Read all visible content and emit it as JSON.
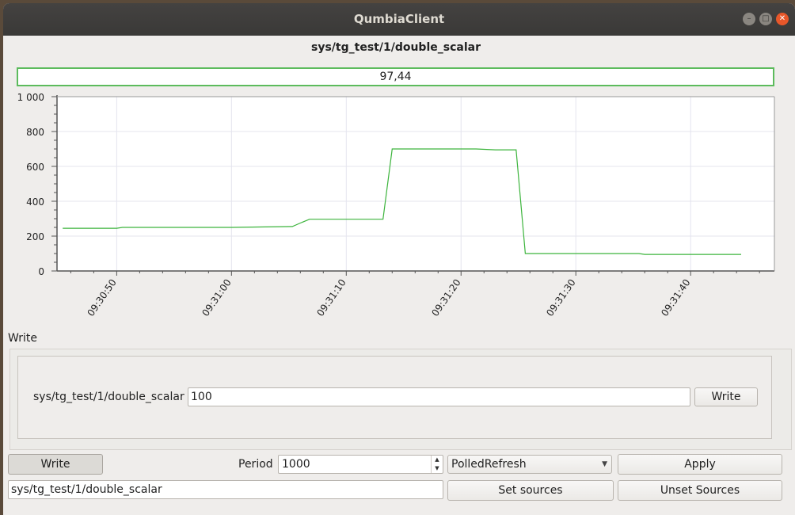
{
  "window": {
    "title": "QumbiaClient",
    "controls": {
      "minimize": "–",
      "maximize": "□",
      "close": "✕"
    }
  },
  "source_title": "sys/tg_test/1/double_scalar",
  "value_display": "97,44",
  "chart_data": {
    "type": "line",
    "title": "",
    "xlabel": "",
    "ylabel": "",
    "ylim": [
      0,
      1000
    ],
    "y_ticks": [
      0,
      200,
      400,
      600,
      800,
      1000
    ],
    "y_tick_labels": [
      "0",
      "200",
      "400",
      "600",
      "800",
      "1 000"
    ],
    "x_tick_labels": [
      "09:30:50",
      "09:31:00",
      "09:31:10",
      "09:31:20",
      "09:31:30",
      "09:31:40"
    ],
    "x_tick_seconds": [
      50,
      60,
      70,
      80,
      90,
      100
    ],
    "xlim_seconds": [
      44.8,
      107.3
    ],
    "line_color": "#3cb43c",
    "grid": true,
    "series": [
      {
        "x_seconds": [
          45.3,
          50,
          50.5,
          60,
          65.3,
          66,
          66.8,
          73.2,
          74,
          80,
          81.3,
          83,
          84.8,
          85.6,
          86,
          95.5,
          96,
          104.4
        ],
        "values": [
          245,
          245,
          250,
          250,
          255,
          275,
          297,
          297,
          700,
          700,
          700,
          695,
          695,
          100,
          100,
          100,
          95,
          95
        ]
      }
    ]
  },
  "write_group": {
    "label": "Write",
    "source_label": "sys/tg_test/1/double_scalar",
    "input_value": "100",
    "write_button": "Write"
  },
  "bottom": {
    "write_toggle": "Write",
    "period_label": "Period",
    "period_value": "1000",
    "refresh_mode": "PolledRefresh",
    "apply_button": "Apply",
    "sources_value": "sys/tg_test/1/double_scalar",
    "set_sources_button": "Set sources",
    "unset_sources_button": "Unset Sources"
  }
}
